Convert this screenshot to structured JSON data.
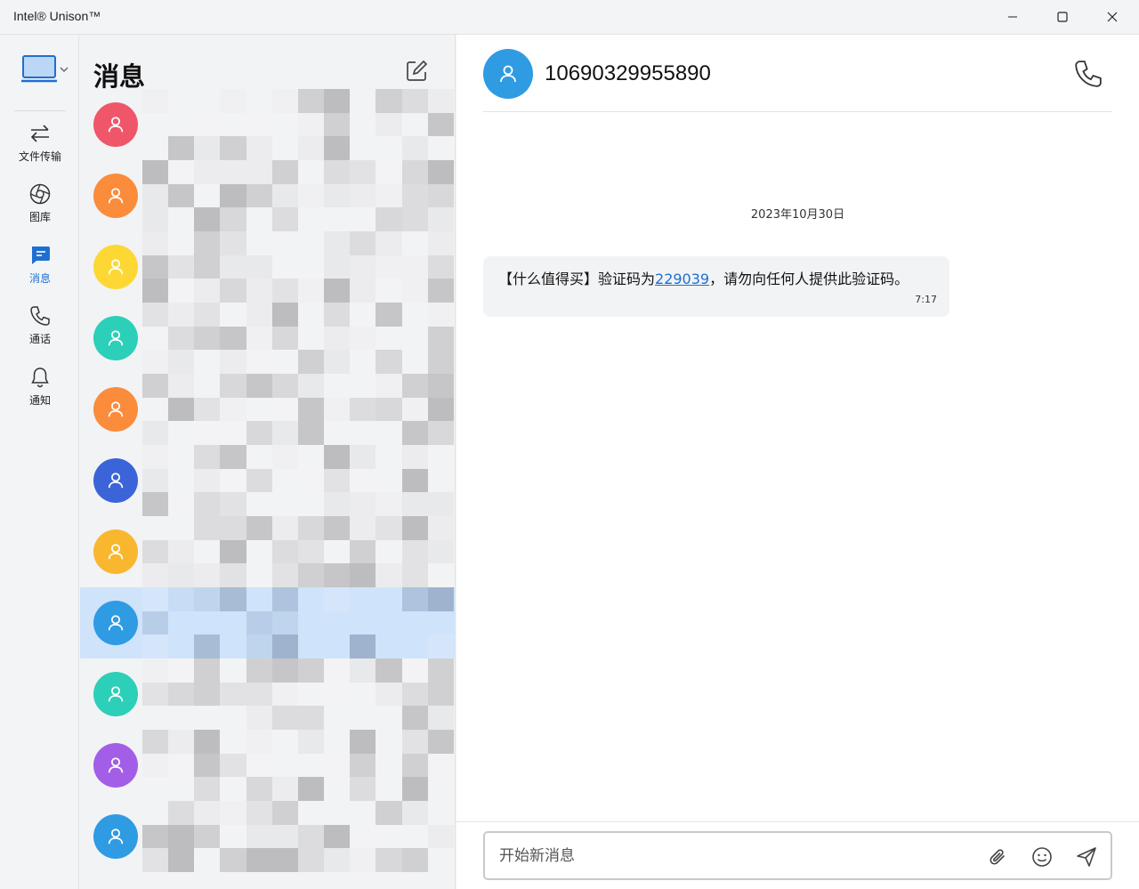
{
  "window": {
    "title": "Intel® Unison™",
    "buttons": [
      "minimize",
      "maximize",
      "close"
    ]
  },
  "nav": {
    "device_icon": "laptop-icon",
    "items": [
      {
        "label": "文件传输",
        "icon": "transfer-icon",
        "active": false
      },
      {
        "label": "图库",
        "icon": "gallery-icon",
        "active": false
      },
      {
        "label": "消息",
        "icon": "messages-icon",
        "active": true
      },
      {
        "label": "通话",
        "icon": "phone-icon",
        "active": false
      },
      {
        "label": "通知",
        "icon": "bell-icon",
        "active": false
      }
    ]
  },
  "list": {
    "title": "消息",
    "compose_icon": "compose-icon",
    "conversations": [
      {
        "avatar_color": "#f0566a",
        "selected": false
      },
      {
        "avatar_color": "#fb8c3c",
        "selected": false
      },
      {
        "avatar_color": "#fdd835",
        "selected": false
      },
      {
        "avatar_color": "#2ccfb8",
        "selected": false
      },
      {
        "avatar_color": "#fb8c3c",
        "selected": false
      },
      {
        "avatar_color": "#3a64d8",
        "selected": false
      },
      {
        "avatar_color": "#f8b72f",
        "selected": false
      },
      {
        "avatar_color": "#2f9be3",
        "selected": true
      },
      {
        "avatar_color": "#2ccfb8",
        "selected": false
      },
      {
        "avatar_color": "#a35ee8",
        "selected": false
      },
      {
        "avatar_color": "#2f9be3",
        "selected": false
      }
    ]
  },
  "chat": {
    "contact": "10690329955890",
    "date": "2023年10月30日",
    "message": {
      "prefix": "【什么值得买】验证码为",
      "code": "229039",
      "suffix": "，请勿向任何人提供此验证码。",
      "time": "7:17"
    },
    "input_placeholder": "开始新消息",
    "accent": "#1f6fd1"
  }
}
